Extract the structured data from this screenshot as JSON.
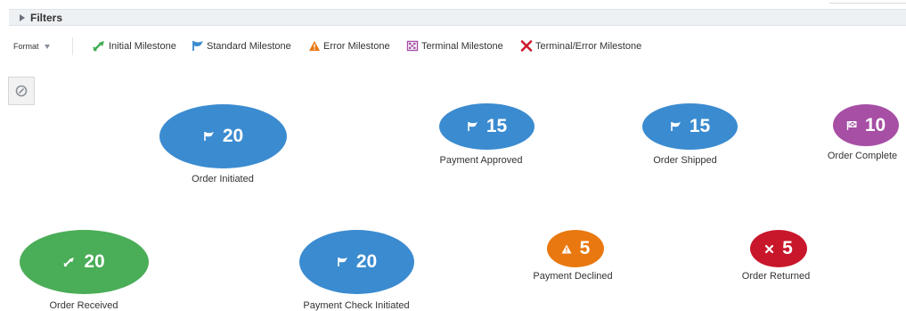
{
  "filters": {
    "label": "Filters"
  },
  "toolbar": {
    "format_label": "Format"
  },
  "legend": [
    {
      "key": "initial",
      "label": "Initial Milestone",
      "icon": "initial-milestone-icon",
      "color": "#3fad50"
    },
    {
      "key": "standard",
      "label": "Standard Milestone",
      "icon": "standard-milestone-icon",
      "color": "#3b8bd0"
    },
    {
      "key": "error",
      "label": "Error Milestone",
      "icon": "error-milestone-icon",
      "color": "#e8780f"
    },
    {
      "key": "terminal",
      "label": "Terminal Milestone",
      "icon": "terminal-milestone-icon",
      "color": "#a64fa5"
    },
    {
      "key": "terminal_error",
      "label": "Terminal/Error Milestone",
      "icon": "terminal-error-milestone-icon",
      "color": "#cc1a2b"
    }
  ],
  "milestones": [
    {
      "key": "order_initiated",
      "type": "standard",
      "count": "20",
      "label": "Order Initiated",
      "color": "#3b8bd0"
    },
    {
      "key": "payment_approved",
      "type": "standard",
      "count": "15",
      "label": "Payment Approved",
      "color": "#3b8bd0"
    },
    {
      "key": "order_shipped",
      "type": "standard",
      "count": "15",
      "label": "Order Shipped",
      "color": "#3b8bd0"
    },
    {
      "key": "order_complete",
      "type": "terminal",
      "count": "10",
      "label": "Order Complete",
      "color": "#a64fa5"
    },
    {
      "key": "order_received",
      "type": "initial",
      "count": "20",
      "label": "Order Received",
      "color": "#4aad57"
    },
    {
      "key": "payment_check_initiated",
      "type": "standard",
      "count": "20",
      "label": "Payment Check Initiated",
      "color": "#3b8bd0"
    },
    {
      "key": "payment_declined",
      "type": "error",
      "count": "5",
      "label": "Payment Declined",
      "color": "#e8780f"
    },
    {
      "key": "order_returned",
      "type": "terminal_error",
      "count": "5",
      "label": "Order Returned",
      "color": "#c8172b"
    }
  ]
}
